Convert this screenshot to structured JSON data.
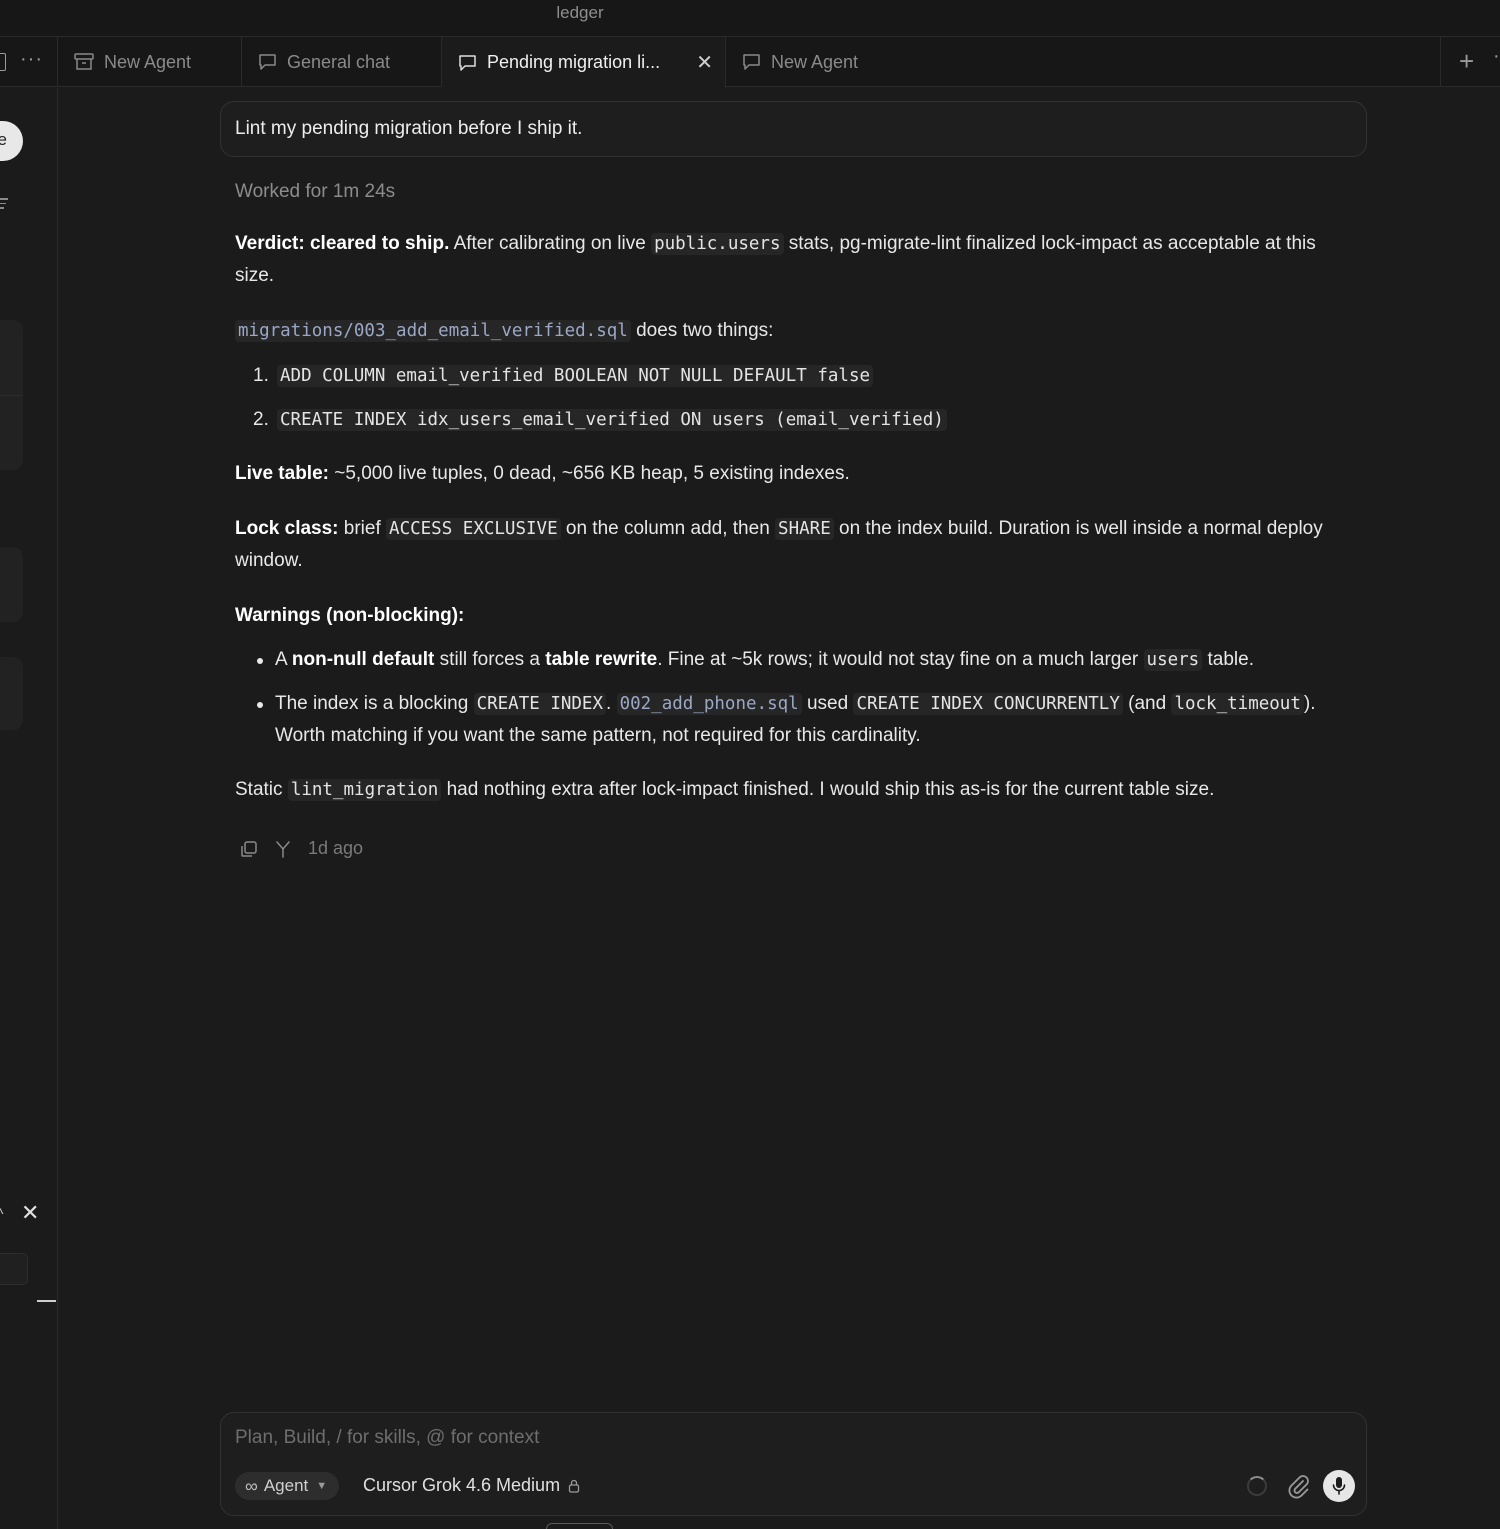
{
  "window": {
    "title": "ledger"
  },
  "tabs": [
    {
      "label": "New Agent",
      "icon": "archive-icon"
    },
    {
      "label": "General chat",
      "icon": "chat-bubble-icon"
    },
    {
      "label": "Pending migration li...",
      "icon": "chat-bubble-icon",
      "active": true
    },
    {
      "label": "New Agent",
      "icon": "chat-bubble-icon"
    }
  ],
  "sidebar": {
    "pill_label": "e"
  },
  "chat": {
    "user_message": "Lint my pending migration before I ship it.",
    "worked_for": "Worked for 1m 24s",
    "verdict": {
      "label": "Verdict: cleared to ship.",
      "t1": " After calibrating on live ",
      "c1": "public.users",
      "t2": " stats, pg-migrate-lint finalized lock-impact as acceptable at this size."
    },
    "migration": {
      "file": "migrations/003_add_email_verified.sql",
      "text": " does two things:",
      "steps": [
        {
          "num": "1.",
          "code": "ADD COLUMN email_verified BOOLEAN NOT NULL DEFAULT false"
        },
        {
          "num": "2.",
          "code": "CREATE INDEX idx_users_email_verified ON users (email_verified)"
        }
      ]
    },
    "live_table": {
      "label": "Live table:",
      "text": " ~5,000 live tuples, 0 dead, ~656 KB heap, 5 existing indexes."
    },
    "lock_class": {
      "label": "Lock class:",
      "t1": " brief ",
      "c1": "ACCESS EXCLUSIVE",
      "t2": " on the column add, then ",
      "c2": "SHARE",
      "t3": " on the index build. Duration is well inside a normal deploy window."
    },
    "warnings": {
      "label": "Warnings (non-blocking):",
      "w1": {
        "t1": "A ",
        "b1": "non-null default",
        "t2": " still forces a ",
        "b2": "table rewrite",
        "t3": ". Fine at ~5k rows; it would not stay fine on a much larger ",
        "c1": "users",
        "t4": " table."
      },
      "w2": {
        "t1": "The index is a blocking ",
        "c1": "CREATE INDEX",
        "t2": ". ",
        "c2": "002_add_phone.sql",
        "t3": " used ",
        "c3": "CREATE INDEX CONCURRENTLY",
        "t4": " (and ",
        "c4": "lock_timeout",
        "t5": "). Worth matching if you want the same pattern, not required for this cardinality."
      }
    },
    "static": {
      "t1": "Static ",
      "c1": "lint_migration",
      "t2": " had nothing extra after lock-impact finished. I would ship this as-is for the current table size."
    },
    "timestamp": "1d ago"
  },
  "composer": {
    "placeholder": "Plan, Build, / for skills, @ for context",
    "mode_label": "Agent",
    "model_label": "Cursor Grok 4.6 Medium"
  }
}
